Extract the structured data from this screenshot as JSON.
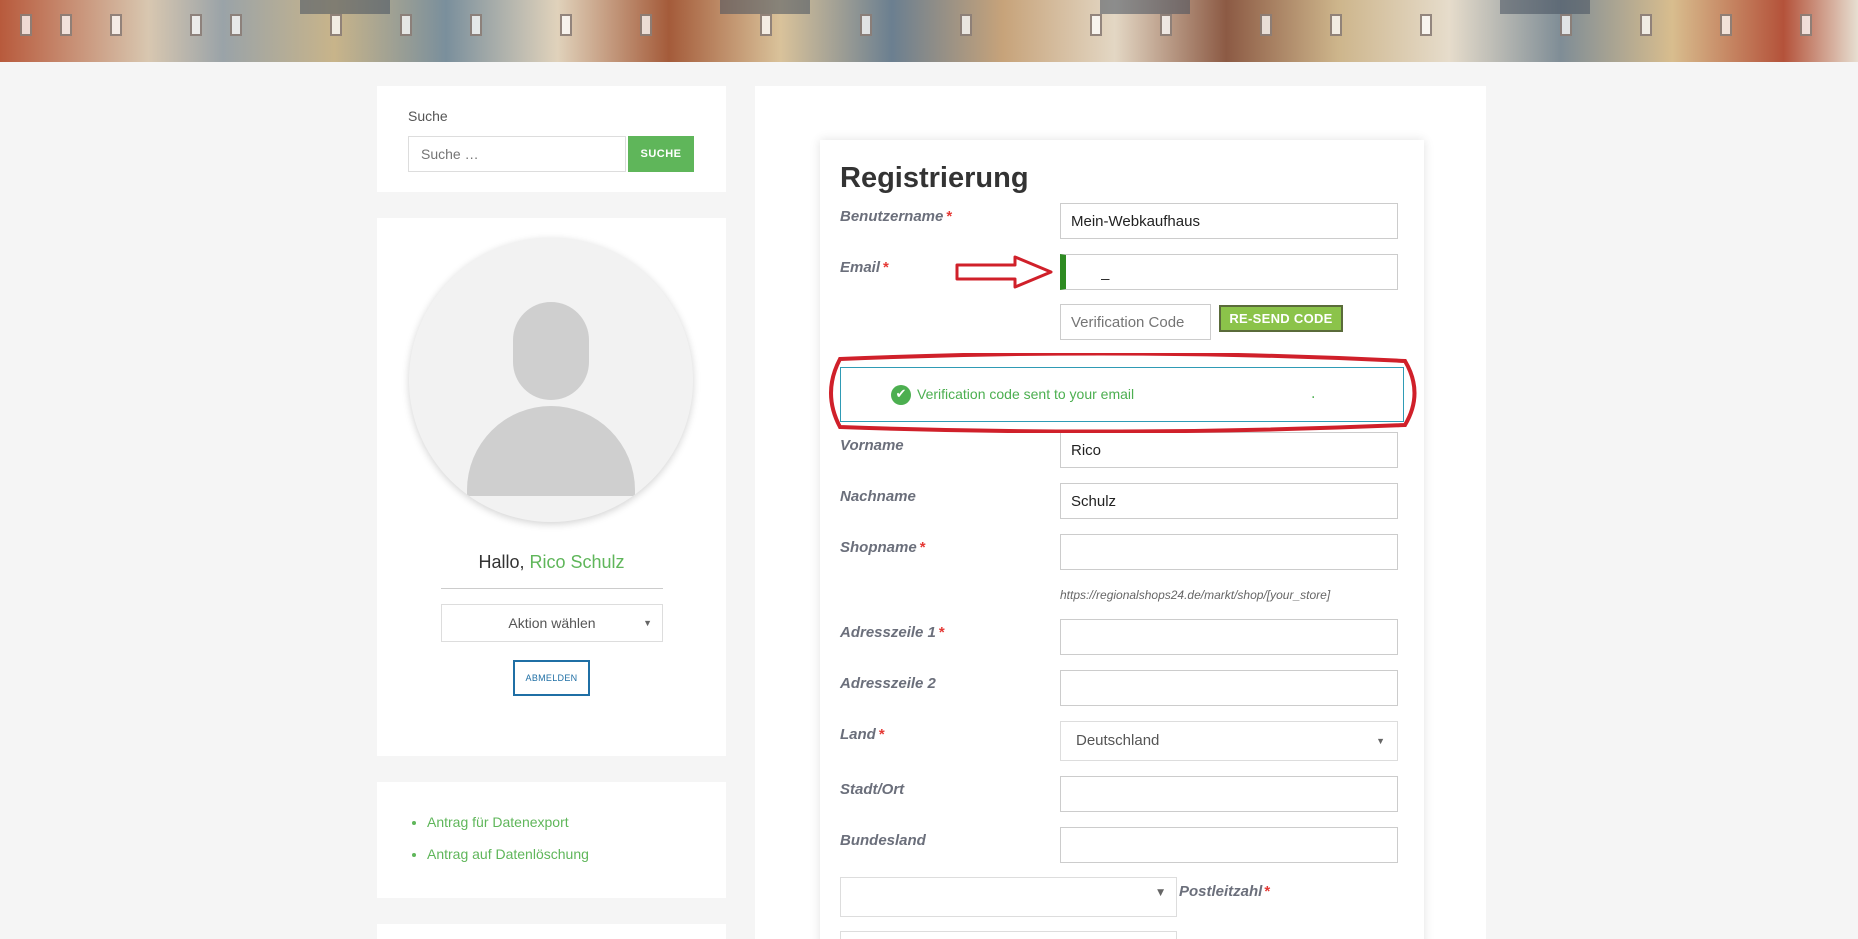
{
  "search": {
    "label": "Suche",
    "placeholder": "Suche …",
    "button_label": "SUCHE"
  },
  "profile": {
    "greeting_prefix": "Hallo,",
    "user_name": "Rico Schulz",
    "action_select": "Aktion wählen",
    "logout_label": "ABMELDEN"
  },
  "links": [
    "Antrag für Datenexport",
    "Antrag auf Datenlöschung"
  ],
  "form": {
    "title": "Registrierung",
    "username_label": "Benutzername",
    "username_value": "Mein-Webkaufhaus",
    "email_label": "Email",
    "email_value": "_",
    "verification_placeholder": "Verification Code",
    "resend_label": "RE-SEND CODE",
    "notice_text": "Verification code sent to your email",
    "notice_trailing": ".",
    "firstname_label": "Vorname",
    "firstname_value": "Rico",
    "lastname_label": "Nachname",
    "lastname_value": "Schulz",
    "shopname_label": "Shopname",
    "shop_url_hint": "https://regionalshops24.de/markt/shop/[your_store]",
    "address1_label": "Adresszeile 1",
    "address2_label": "Adresszeile 2",
    "country_label": "Land",
    "country_value": "Deutschland",
    "city_label": "Stadt/Ort",
    "state_label": "Bundesland",
    "zip_label": "Postleitzahl",
    "required_marker": "*"
  },
  "colors": {
    "accent_green": "#5fb65a",
    "annotation_red": "#d0202a",
    "notice_border": "#2f9bb5"
  }
}
